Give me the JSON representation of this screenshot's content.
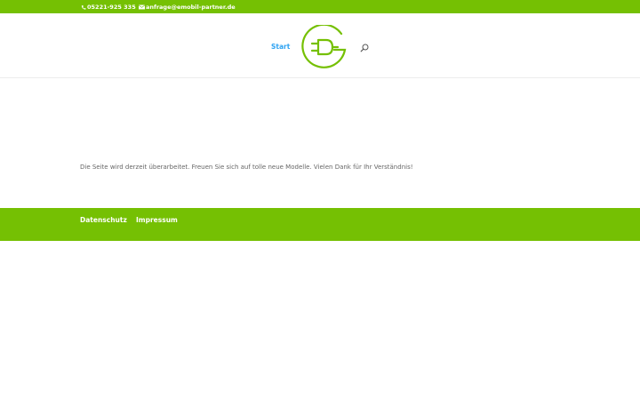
{
  "topbar": {
    "phone": "05221-925 335",
    "email": "anfrage@emobil-partner.de",
    "phone_icon": "phone-icon",
    "email_icon": "envelope-icon"
  },
  "header": {
    "nav_start": "Start",
    "logo": "plug-g-logo",
    "search_icon": "search-icon"
  },
  "main": {
    "text": "Die Seite wird derzeit überarbeitet. Freuen Sie sich auf tolle neue Modelle. Vielen Dank für Ihr Verständnis!"
  },
  "footer": {
    "links": [
      "Datenschutz",
      "Impressum"
    ]
  },
  "colors": {
    "brand_green": "#75c003",
    "link_blue": "#2ea3f2",
    "text_gray": "#666666"
  }
}
